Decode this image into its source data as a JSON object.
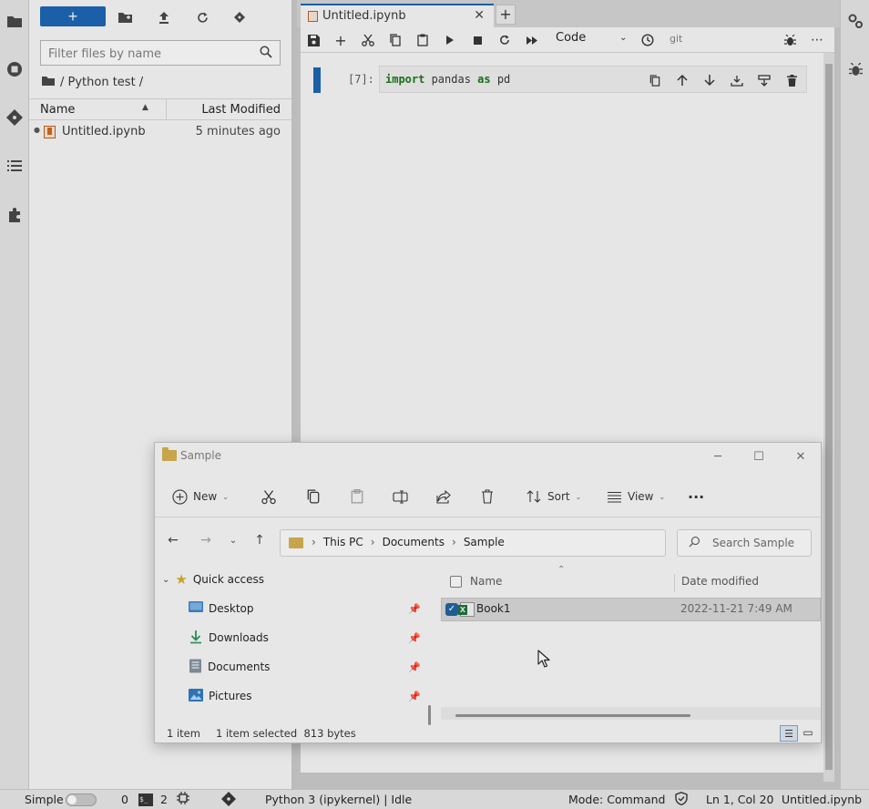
{
  "file_browser": {
    "new_label": "+",
    "filter_placeholder": "Filter files by name",
    "breadcrumb": "/ Python test /",
    "columns": {
      "name": "Name",
      "modified": "Last Modified"
    },
    "files": [
      {
        "name": "Untitled.ipynb",
        "modified": "5 minutes ago"
      }
    ]
  },
  "notebook": {
    "tab_title": "Untitled.ipynb",
    "cell_type": "Code",
    "git_label": "git",
    "cell": {
      "prompt": "[7]:",
      "code": {
        "kw1": "import",
        "mid": " pandas ",
        "kw2": "as",
        "end": " pd"
      }
    }
  },
  "explorer": {
    "title": "Sample",
    "commands": {
      "new": "New",
      "sort": "Sort",
      "view": "View",
      "more": "···"
    },
    "path": [
      "This PC",
      "Documents",
      "Sample"
    ],
    "search_placeholder": "Search Sample",
    "nav_items": [
      {
        "label": "Quick access",
        "icon": "star-icon"
      },
      {
        "label": "Desktop",
        "icon": "desktop-icon"
      },
      {
        "label": "Downloads",
        "icon": "download-icon"
      },
      {
        "label": "Documents",
        "icon": "documents-icon"
      },
      {
        "label": "Pictures",
        "icon": "pictures-icon"
      }
    ],
    "columns": {
      "name": "Name",
      "date": "Date modified"
    },
    "files": [
      {
        "name": "Book1",
        "date": "2022-11-21 7:49 AM",
        "selected": true
      }
    ],
    "status": {
      "count": "1 item",
      "selection": "1 item selected  813 bytes"
    }
  },
  "status_bar": {
    "mode_label": "Simple",
    "terminals_count": "0",
    "kernels_count": "2",
    "kernel": "Python 3 (ipykernel) | Idle",
    "mode": "Mode: Command",
    "position": "Ln 1, Col 20",
    "file": "Untitled.ipynb"
  },
  "colors": {
    "accent": "#1a5fa8",
    "overlay_gray": "#bdbdbd"
  }
}
